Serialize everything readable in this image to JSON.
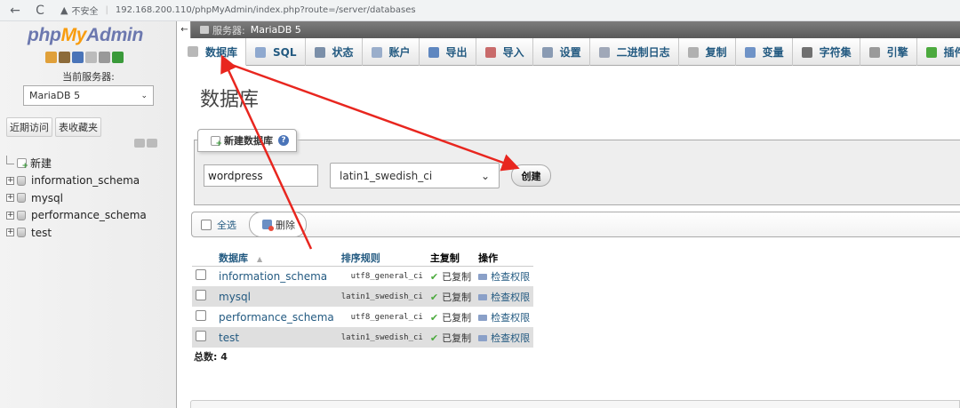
{
  "browser": {
    "back_icon": "←",
    "reload_icon": "C",
    "warn_icon": "▲",
    "insecure_label": "不安全",
    "url": "192.168.200.110/phpMyAdmin/index.php?route=/server/databases"
  },
  "sidebar": {
    "logo_php": "php",
    "logo_my": "My",
    "logo_admin": "Admin",
    "current_server_label": "当前服务器:",
    "server_select_value": "MariaDB 5",
    "recent_button": "近期访问",
    "favorites_button": "表收藏夹",
    "tree": [
      {
        "label": "新建",
        "kind": "new"
      },
      {
        "label": "information_schema",
        "kind": "db"
      },
      {
        "label": "mysql",
        "kind": "db"
      },
      {
        "label": "performance_schema",
        "kind": "db"
      },
      {
        "label": "test",
        "kind": "db"
      }
    ]
  },
  "server_bar": {
    "label": "服务器:",
    "value": "MariaDB 5"
  },
  "tabs": [
    {
      "label": "数据库",
      "icon": "database-icon",
      "active": true
    },
    {
      "label": "SQL",
      "icon": "sql-icon"
    },
    {
      "label": "状态",
      "icon": "status-icon"
    },
    {
      "label": "账户",
      "icon": "users-icon"
    },
    {
      "label": "导出",
      "icon": "export-icon"
    },
    {
      "label": "导入",
      "icon": "import-icon"
    },
    {
      "label": "设置",
      "icon": "wrench-icon"
    },
    {
      "label": "二进制日志",
      "icon": "binlog-icon"
    },
    {
      "label": "复制",
      "icon": "replication-icon"
    },
    {
      "label": "变量",
      "icon": "variables-icon"
    },
    {
      "label": "字符集",
      "icon": "charset-icon"
    },
    {
      "label": "引擎",
      "icon": "engine-icon"
    },
    {
      "label": "插件",
      "icon": "plugin-icon"
    }
  ],
  "main": {
    "page_title": "数据库",
    "create": {
      "legend": "新建数据库",
      "help_icon": "?",
      "db_name_value": "wordpress",
      "collation_value": "latin1_swedish_ci",
      "create_button": "创建"
    },
    "bulk": {
      "check_all": "全选",
      "delete": "删除"
    },
    "table": {
      "headers": {
        "database": "数据库",
        "collation": "排序规则",
        "master_replication": "主复制",
        "action": "操作"
      },
      "sort_indicator": "▲",
      "rows": [
        {
          "name": "information_schema",
          "collation": "utf8_general_ci",
          "replication": "已复制",
          "action": "检查权限"
        },
        {
          "name": "mysql",
          "collation": "latin1_swedish_ci",
          "replication": "已复制",
          "action": "检查权限"
        },
        {
          "name": "performance_schema",
          "collation": "utf8_general_ci",
          "replication": "已复制",
          "action": "检查权限"
        },
        {
          "name": "test",
          "collation": "latin1_swedish_ci",
          "replication": "已复制",
          "action": "检查权限"
        }
      ],
      "total_label": "总数:",
      "total_value": "4"
    }
  },
  "colors": {
    "link": "#235a81",
    "annotation_arrow": "#e8261f",
    "logo_blue": "#6c78af",
    "logo_orange": "#f89c0e"
  }
}
